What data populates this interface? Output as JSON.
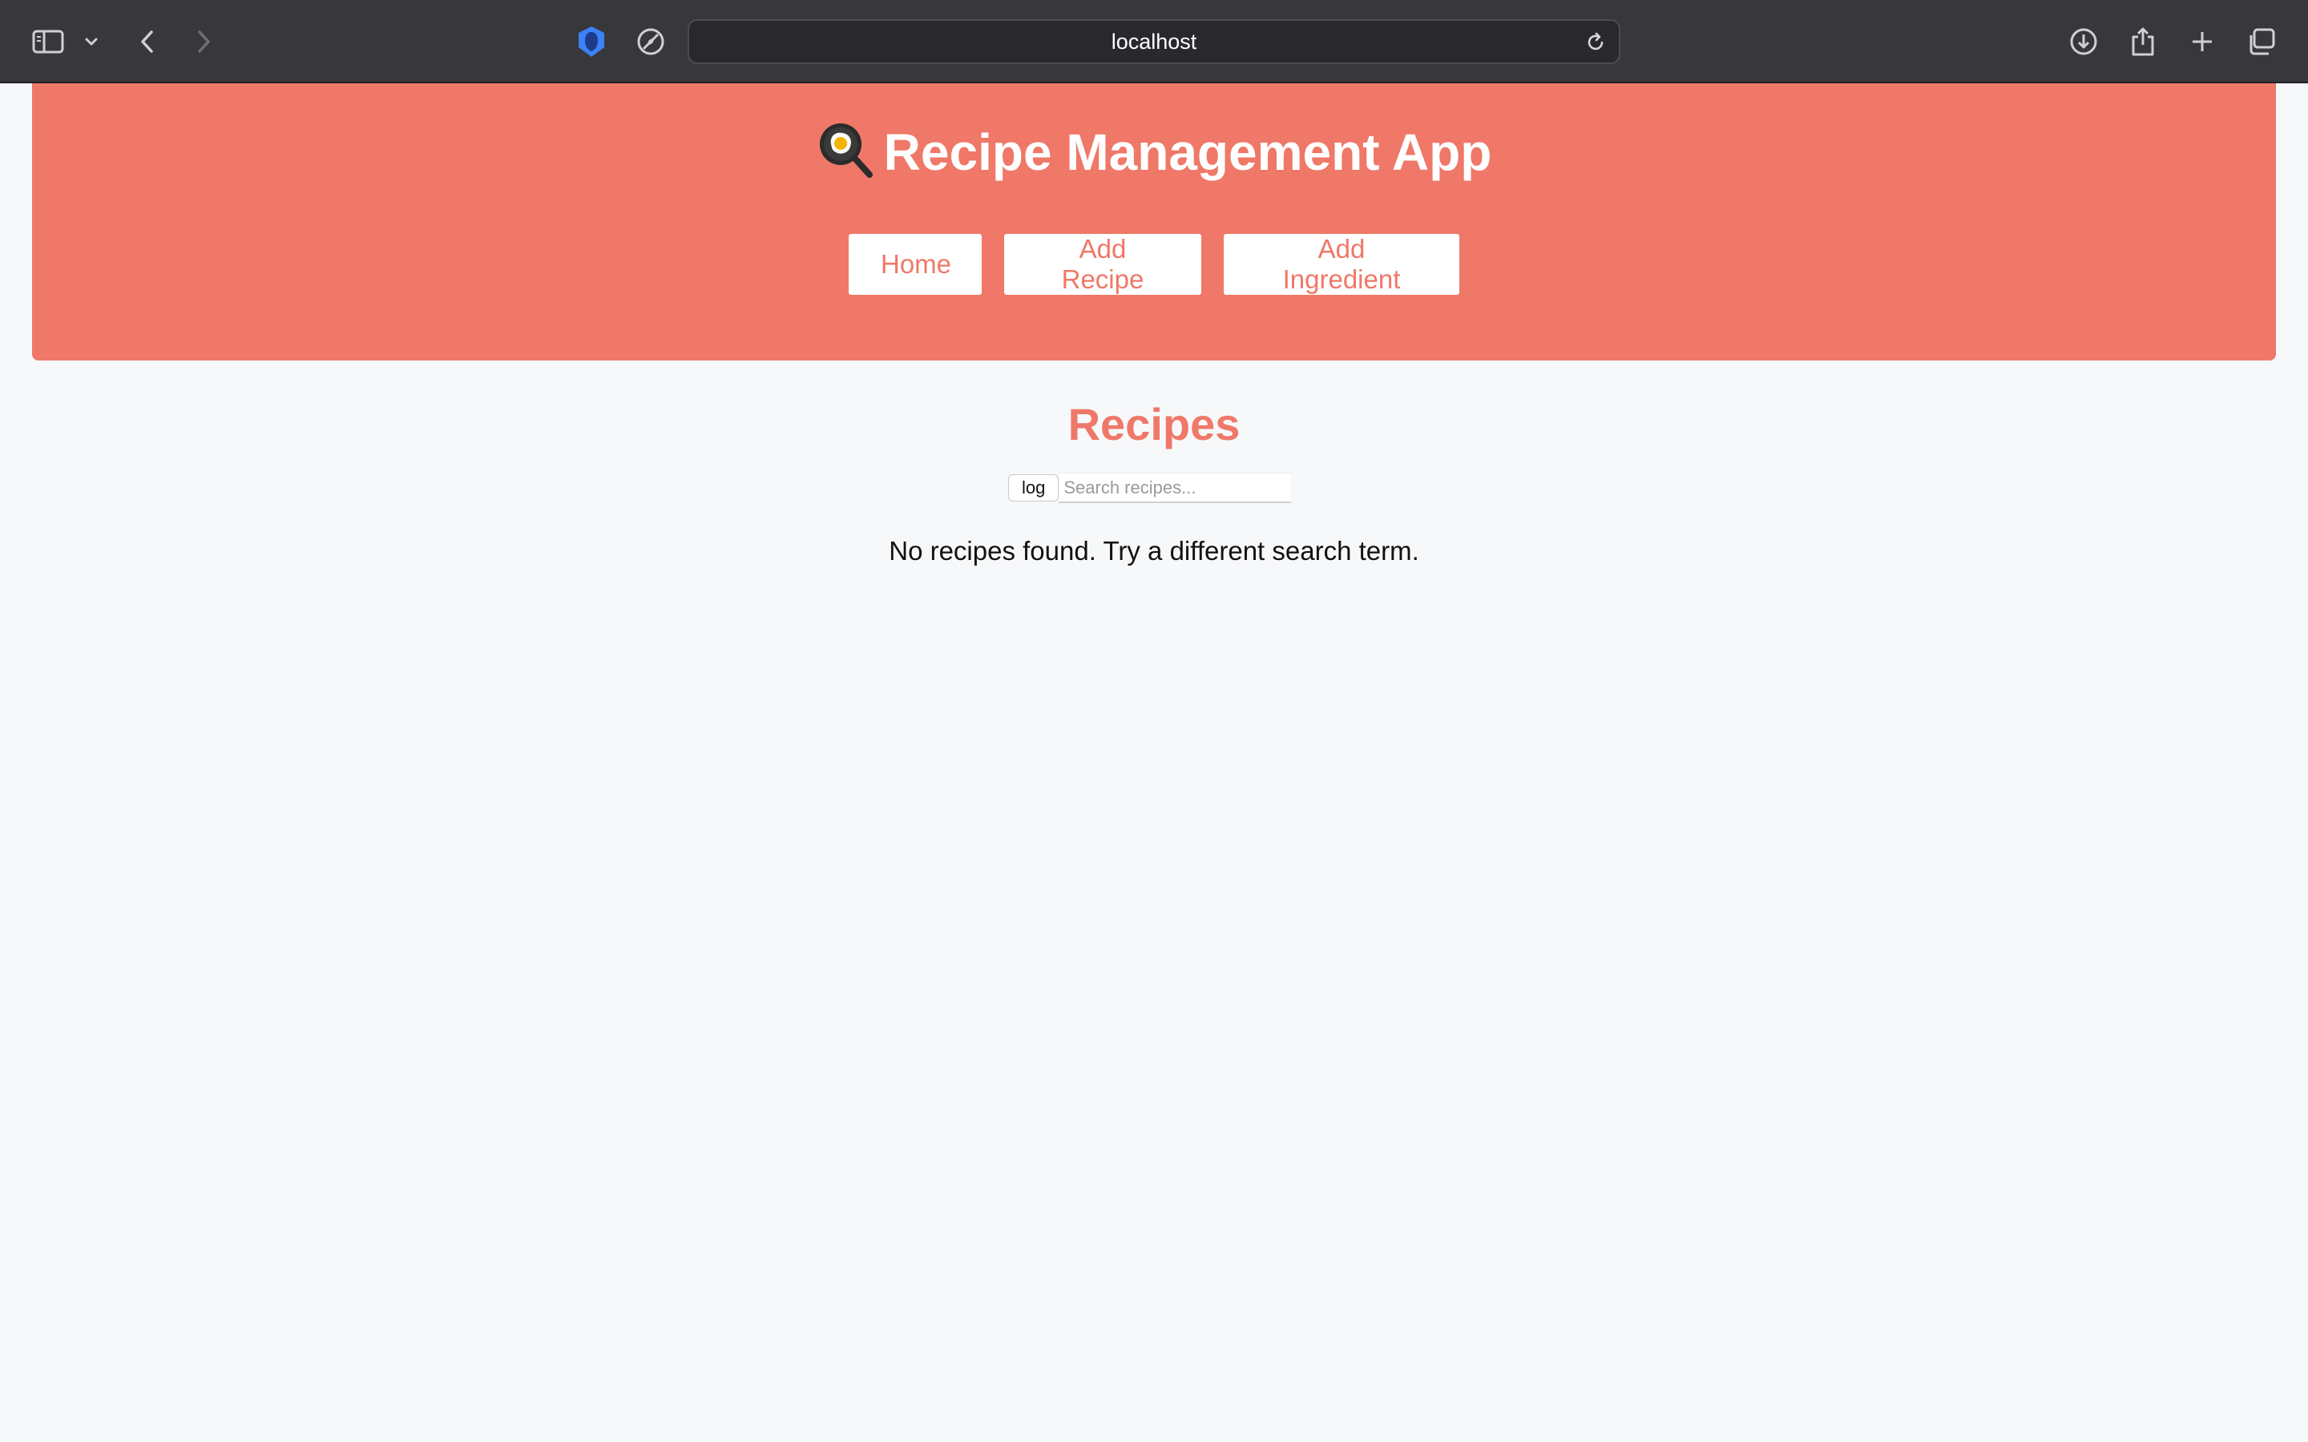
{
  "browser": {
    "url": "localhost",
    "colors": {
      "toolbar": "#38373c",
      "url_bar": "#29282d",
      "shield_accent": "#3b82f6"
    }
  },
  "header": {
    "title": "Recipe Management App",
    "title_icon": "frying-pan-egg-icon",
    "nav": {
      "home": "Home",
      "add_recipe": "Add Recipe",
      "add_ingredient": "Add Ingredient"
    },
    "colors": {
      "background": "#ef7868",
      "button_text": "#ef7868"
    }
  },
  "main": {
    "heading": "Recipes",
    "search": {
      "log_label": "log",
      "placeholder": "Search recipes...",
      "value": ""
    },
    "empty_message": "No recipes found. Try a different search term."
  }
}
